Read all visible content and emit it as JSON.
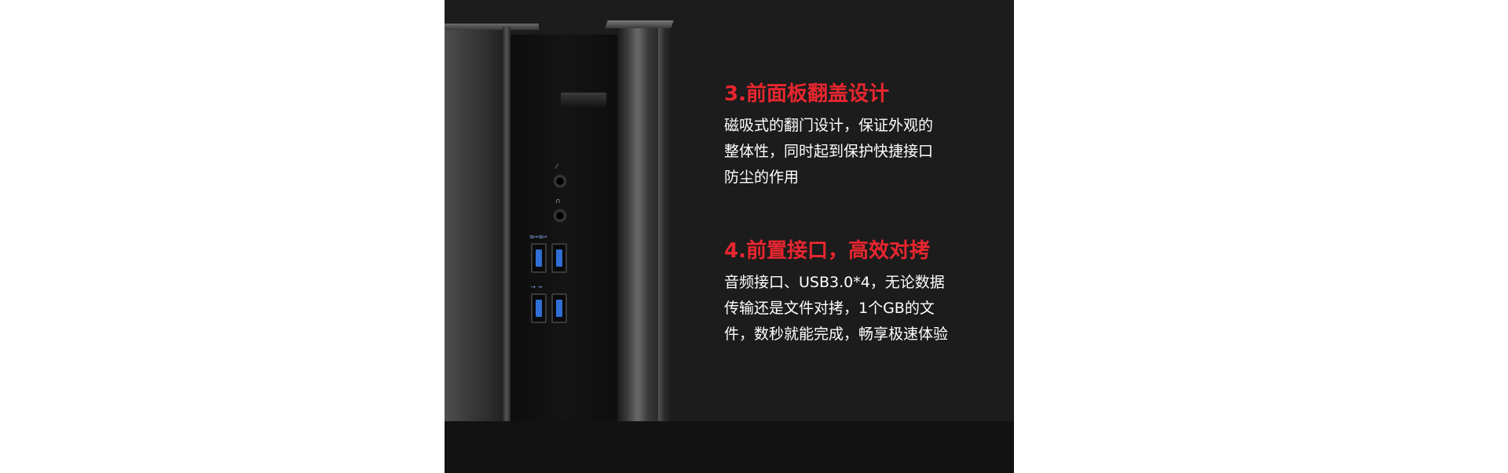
{
  "section_1": {
    "heading": "3.前面板翻盖设计",
    "lines": [
      "磁吸式的翻门设计，保证外观的",
      "整体性，同时起到保护快捷接口",
      "防尘的作用"
    ]
  },
  "section_2": {
    "heading": "4.前置接口，高效对拷",
    "lines": [
      "音频接口、USB3.0*4，无论数据",
      "传输还是文件对拷，1个GB的文",
      "件，数秒就能完成，畅享极速体验"
    ]
  },
  "icons": {
    "mic_jack": "microphone-icon",
    "headphone_jack": "headphone-icon",
    "usb": "usb-icon"
  },
  "colors": {
    "heading": "#e8262f",
    "body_text": "#ffffff",
    "panel_background": "#1c1c1c",
    "page_background": "#ffffff"
  }
}
